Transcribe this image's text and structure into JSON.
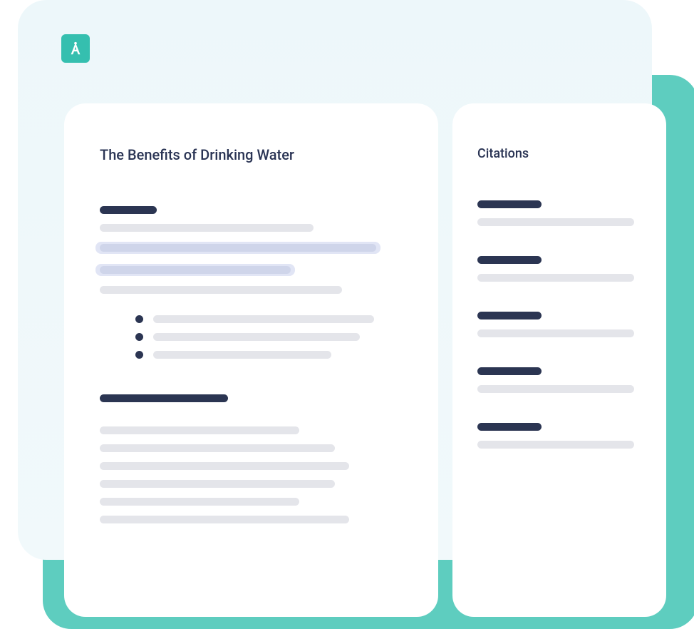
{
  "logo": {
    "letter": "A"
  },
  "document": {
    "title": "The Benefits of Drinking Water"
  },
  "sidebar": {
    "title": "Citations"
  }
}
